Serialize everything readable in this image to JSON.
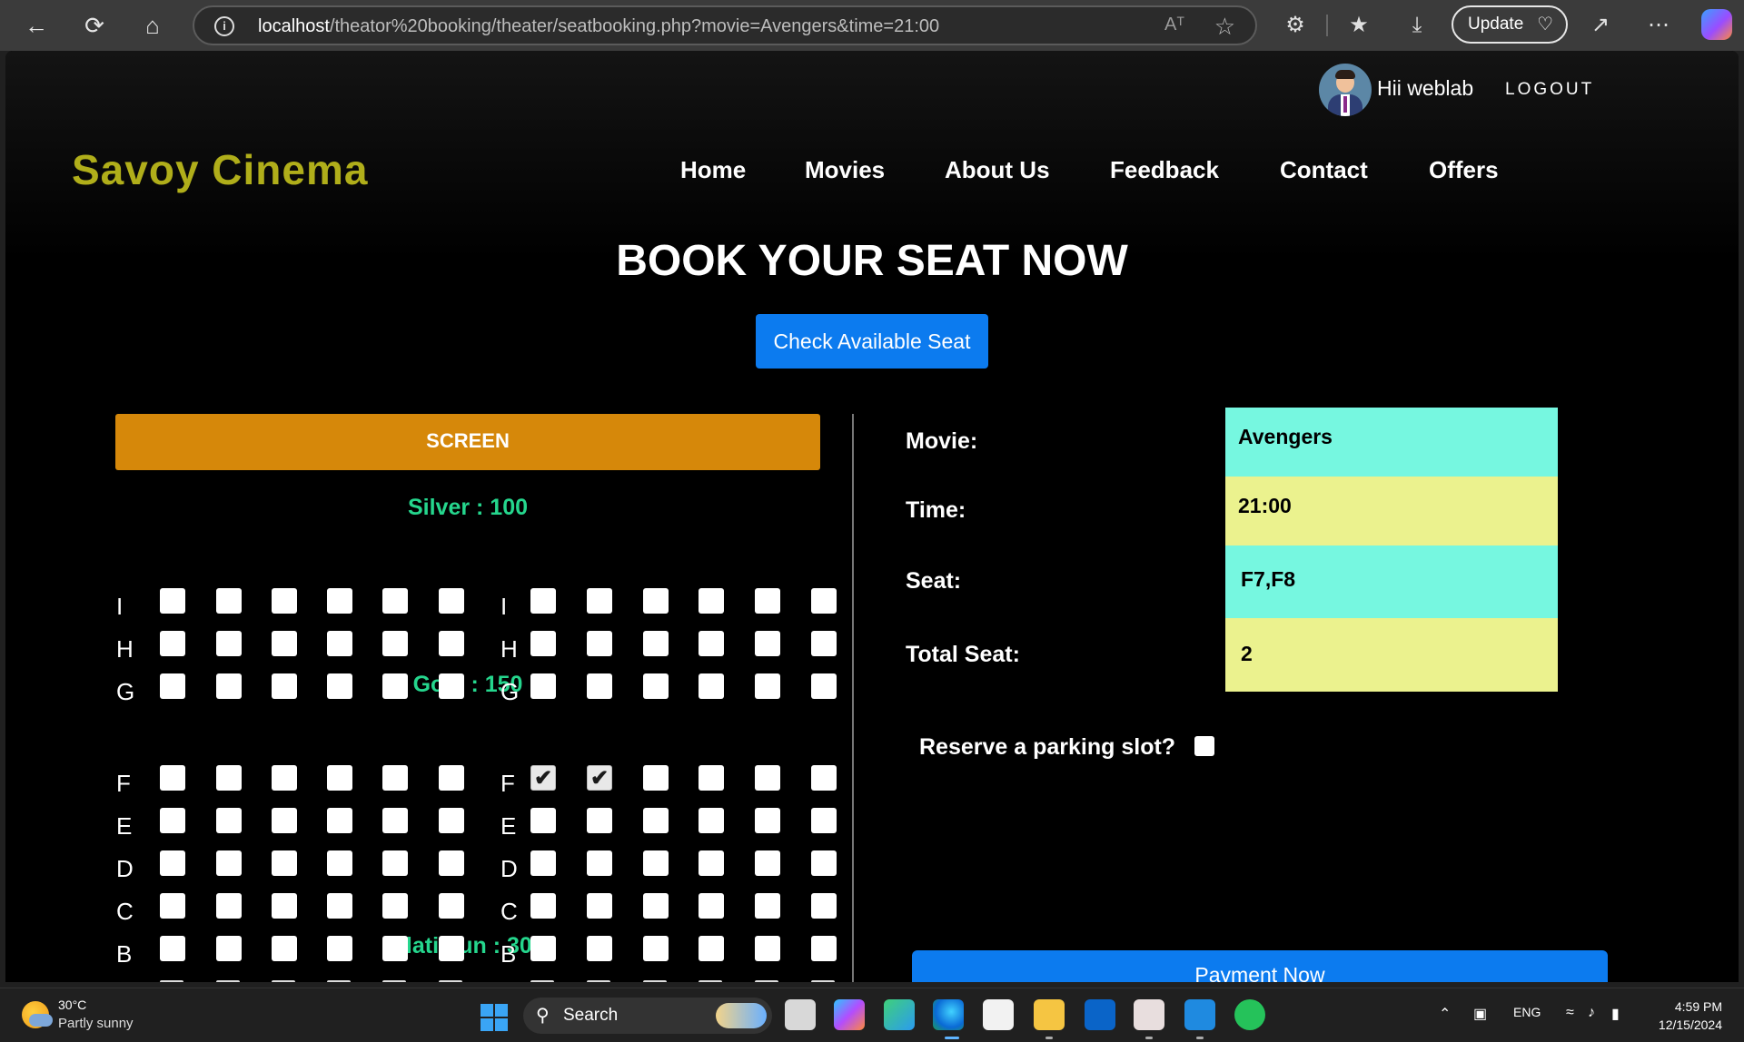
{
  "browser": {
    "url_host": "localhost",
    "url_path": "/theator%20booking/theater/seatbooking.php?movie=Avengers&time=21:00",
    "read_aloud_label": "Aᵀ",
    "update_label": "Update"
  },
  "header": {
    "greeting": "Hii weblab",
    "logout": "LOGOUT",
    "brand": "Savoy Cinema",
    "nav": [
      "Home",
      "Movies",
      "About Us",
      "Feedback",
      "Contact",
      "Offers"
    ]
  },
  "main": {
    "heading": "BOOK YOUR SEAT NOW",
    "check_button": "Check Available Seat",
    "screen_label": "SCREEN",
    "categories": {
      "silver": "Silver : 100",
      "gold": "Gold : 150",
      "platinum": "Platimun : 300"
    },
    "rows": {
      "silver": [
        "I",
        "H",
        "G"
      ],
      "gold": [
        "F",
        "E",
        "D",
        "C",
        "B"
      ]
    },
    "checked_seats": [
      "F7",
      "F8"
    ]
  },
  "details": {
    "movie_label": "Movie:",
    "movie_value": "Avengers",
    "time_label": "Time:",
    "time_value": "21:00",
    "seat_label": "Seat:",
    "seat_value": "F7,F8",
    "total_label": "Total Seat:",
    "total_value": "2",
    "parking_label": "Reserve a parking slot?",
    "payment_button": "Payment Now",
    "colors": {
      "cyan_box": "#76f7e0",
      "yellow_box": "#ebf28e",
      "accent_blue": "#0c7bef",
      "screen_orange": "#d6880a",
      "category_green": "#25d68d",
      "brand_olive": "#b0ae1a"
    }
  },
  "taskbar": {
    "temperature": "30°C",
    "condition": "Partly sunny",
    "search_label": "Search",
    "lang": "ENG",
    "time": "4:59 PM",
    "date": "12/15/2024"
  }
}
